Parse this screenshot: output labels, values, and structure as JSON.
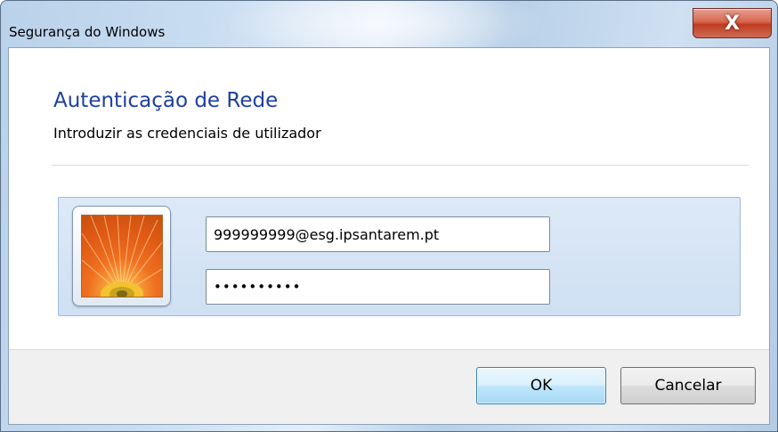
{
  "window": {
    "title": "Segurança do Windows",
    "close_symbol": "X",
    "close_icon": "close-icon"
  },
  "content": {
    "heading": "Autenticação de Rede",
    "subheading": "Introduzir as credenciais de utilizador"
  },
  "credentials": {
    "avatar_icon": "user-avatar-flower-icon",
    "username_value": "999999999@esg.ipsantarem.pt",
    "password_value": "••••••••••"
  },
  "buttons": {
    "ok_label": "OK",
    "cancel_label": "Cancelar"
  },
  "colors": {
    "heading": "#1e3f9e",
    "panel_bg": "#d5e4f5",
    "close_button": "#c9412a"
  }
}
